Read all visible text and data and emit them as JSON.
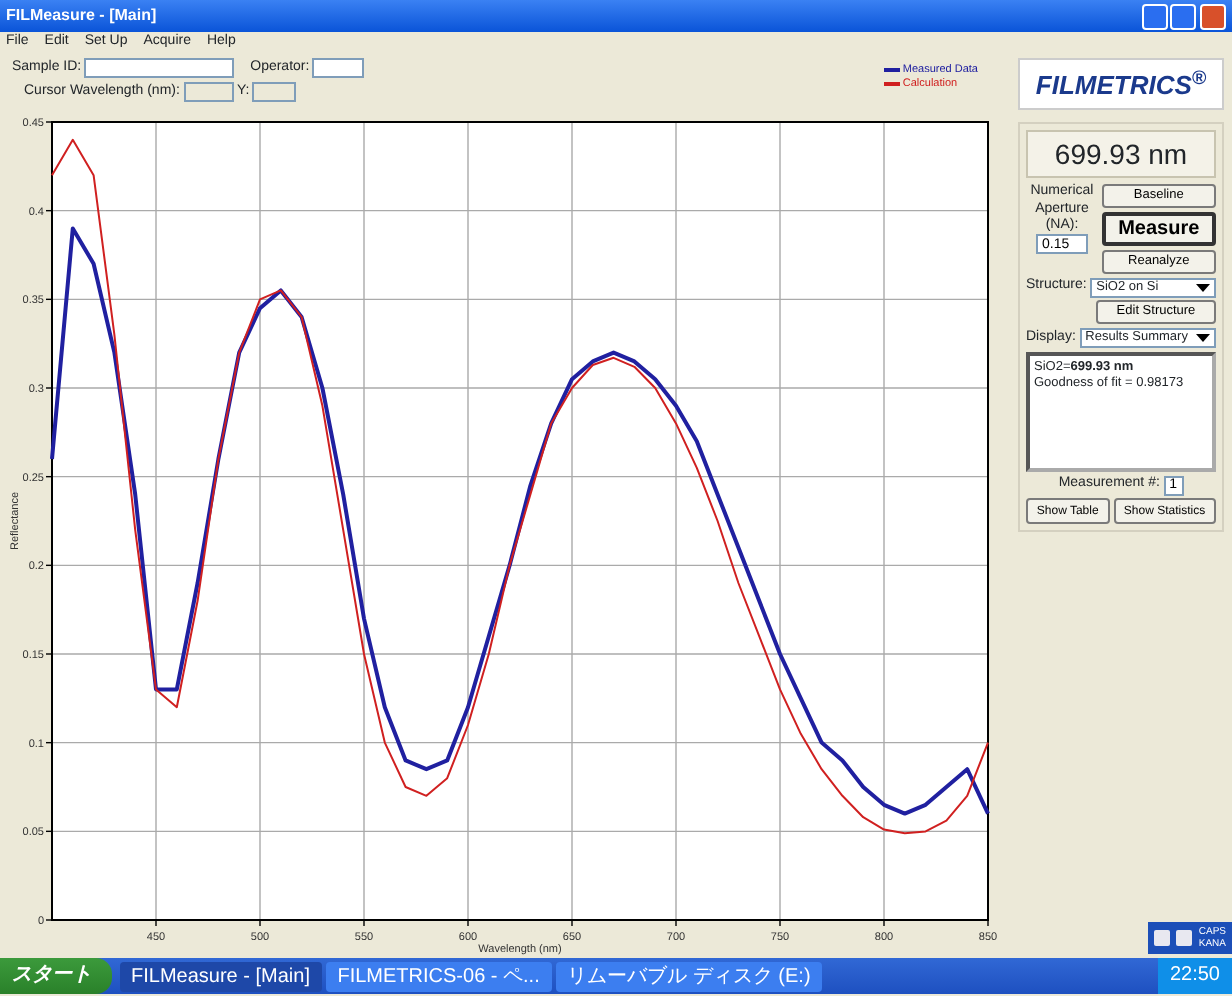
{
  "window": {
    "title": "FILMeasure - [Main]"
  },
  "menu": [
    "File",
    "Edit",
    "Set Up",
    "Acquire",
    "Help"
  ],
  "toolbar": {
    "sample_id_label": "Sample ID:",
    "operator_label": "Operator:",
    "cursor_label": "Cursor Wavelength (nm):",
    "y_label": "Y:"
  },
  "chart": {
    "chart_data": {
      "type": "line",
      "grid": true,
      "xlabel": "Wavelength (nm)",
      "ylabel": "Reflectance",
      "x": [
        400,
        410,
        420,
        430,
        440,
        450,
        460,
        470,
        480,
        490,
        500,
        510,
        520,
        530,
        540,
        550,
        560,
        570,
        580,
        590,
        600,
        610,
        620,
        630,
        640,
        650,
        660,
        670,
        680,
        690,
        700,
        710,
        720,
        730,
        740,
        750,
        760,
        770,
        780,
        790,
        800,
        810,
        820,
        830,
        840,
        850
      ],
      "xlim": [
        400,
        850
      ],
      "ylim": [
        0,
        0.45
      ],
      "xticks": [
        450,
        500,
        550,
        600,
        650,
        700,
        750,
        800,
        850
      ],
      "yticks": [
        0,
        0.05,
        0.1,
        0.15,
        0.2,
        0.25,
        0.3,
        0.35,
        0.4,
        0.45
      ],
      "series": [
        {
          "name": "Measured Data",
          "color": "#2020a0",
          "values": [
            0.26,
            0.39,
            0.37,
            0.32,
            0.24,
            0.13,
            0.13,
            0.19,
            0.26,
            0.32,
            0.345,
            0.355,
            0.34,
            0.3,
            0.24,
            0.17,
            0.12,
            0.09,
            0.085,
            0.09,
            0.12,
            0.16,
            0.2,
            0.245,
            0.28,
            0.305,
            0.315,
            0.32,
            0.315,
            0.305,
            0.29,
            0.27,
            0.24,
            0.21,
            0.18,
            0.15,
            0.125,
            0.1,
            0.09,
            0.075,
            0.065,
            0.06,
            0.065,
            0.075,
            0.085,
            0.06
          ]
        },
        {
          "name": "Calculation",
          "color": "#d02020",
          "values": [
            0.42,
            0.44,
            0.42,
            0.33,
            0.22,
            0.13,
            0.12,
            0.18,
            0.26,
            0.32,
            0.35,
            0.355,
            0.34,
            0.29,
            0.22,
            0.15,
            0.1,
            0.075,
            0.07,
            0.08,
            0.11,
            0.15,
            0.2,
            0.24,
            0.28,
            0.3,
            0.313,
            0.317,
            0.312,
            0.3,
            0.28,
            0.255,
            0.225,
            0.19,
            0.16,
            0.13,
            0.105,
            0.085,
            0.07,
            0.058,
            0.051,
            0.049,
            0.05,
            0.056,
            0.07,
            0.1
          ]
        }
      ]
    }
  },
  "panel": {
    "logo": "FILMETRICS$^{®}$",
    "result": "699.93 nm",
    "na_label": "Numerical Aperture (NA):",
    "na_value": "0.15",
    "buttons": [
      "Baseline",
      "Measure",
      "Reanalyze"
    ],
    "structure_label": "Structure:",
    "structure": "SiO2 on Si",
    "edit_structure": "Edit Structure",
    "display_label": "Display:",
    "display": "Results Summary",
    "results": [
      "SiO2=**699.93 nm**",
      "Goodness of fit = 0.98173"
    ],
    "measurement_label": "Measurement #:",
    "measurement": "1",
    "bottom_buttons": [
      "Show Table",
      "Show Statistics"
    ]
  },
  "language_bar": [
    "CAPS",
    "KANA"
  ],
  "taskbar": {
    "start": "スタート",
    "tasks": [
      {
        "label": "FILMeasure - [Main]",
        "selected": true
      },
      {
        "label": "FILMETRICS-06 - ペ...",
        "selected": false
      },
      {
        "label": "リムーバブル ディスク (E:)",
        "selected": false
      }
    ],
    "clock": "22:50"
  }
}
